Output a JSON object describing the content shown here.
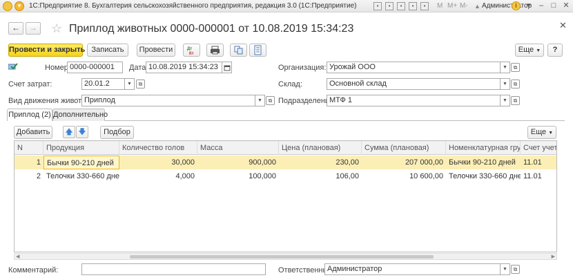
{
  "window": {
    "title": "1С:Предприятие 8. Бухгалтерия сельскохозяйственного предприятия, редакция 3.0  (1С:Предприятие)",
    "m_label": "M",
    "mplus_label": "M+",
    "mminus_label": "M-",
    "user": "Администратор"
  },
  "document": {
    "title": "Приплод животных 0000-000001 от 10.08.2019 15:34:23"
  },
  "toolbar": {
    "post_close": "Провести и закрыть",
    "save": "Записать",
    "post": "Провести",
    "more": "Еще"
  },
  "form": {
    "number_label": "Номер:",
    "number_value": "0000-000001",
    "date_label": "Дата:",
    "date_value": "10.08.2019 15:34:23",
    "org_label": "Организация:",
    "org_value": "Урожай ООО",
    "cost_account_label": "Счет затрат:",
    "cost_account_value": "20.01.2",
    "warehouse_label": "Склад:",
    "warehouse_value": "Основной склад",
    "movement_label": "Вид движения животных:",
    "movement_value": "Приплод",
    "department_label": "Подразделение:",
    "department_value": "МТФ 1",
    "comment_label": "Комментарий:",
    "comment_value": "",
    "responsible_label": "Ответственный:",
    "responsible_value": "Администратор"
  },
  "tabs": [
    {
      "label": "Приплод (2)"
    },
    {
      "label": "Дополнительно"
    }
  ],
  "table_toolbar": {
    "add": "Добавить",
    "pick": "Подбор",
    "more": "Еще"
  },
  "table": {
    "columns": [
      "N",
      "Продукция",
      "Количество голов",
      "Масса",
      "Цена (плановая)",
      "Сумма (плановая)",
      "Номенклатурная груп...",
      "Счет учета"
    ],
    "rows": [
      {
        "n": "1",
        "product": "Бычки 90-210 дней",
        "heads": "30,000",
        "mass": "900,000",
        "price": "230,00",
        "sum": "207 000,00",
        "group": "Бычки 90-210 дней",
        "account": "11.01"
      },
      {
        "n": "2",
        "product": "Телочки 330-660 дней",
        "heads": "4,000",
        "mass": "100,000",
        "price": "106,00",
        "sum": "10 600,00",
        "group": "Телочки 330-660 дней",
        "account": "11.01"
      }
    ]
  }
}
